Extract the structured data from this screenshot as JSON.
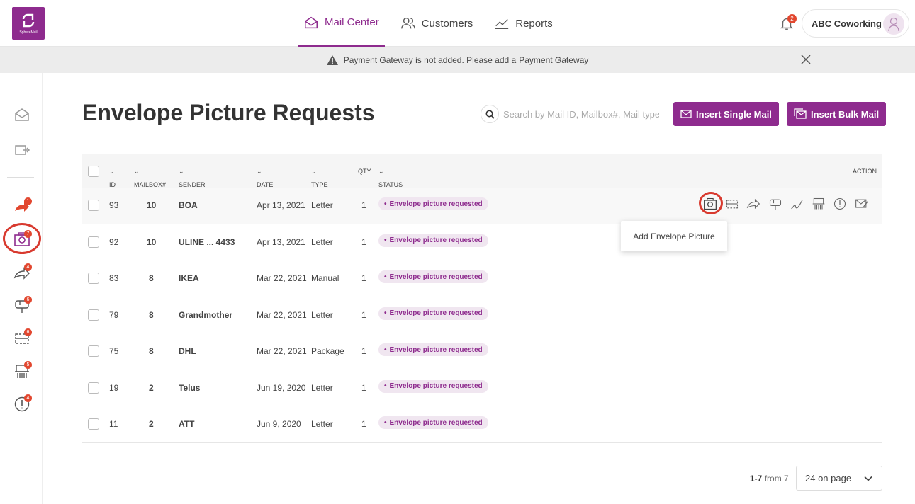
{
  "brand": {
    "logo_text": "SphereMail",
    "accent": "#8e2b8e"
  },
  "nav": {
    "items": [
      {
        "label": "Mail Center",
        "icon": "mail-open-icon",
        "active": true
      },
      {
        "label": "Customers",
        "icon": "users-icon",
        "active": false
      },
      {
        "label": "Reports",
        "icon": "line-chart-icon",
        "active": false
      }
    ],
    "notifications_count": "2",
    "account_name": "ABC Coworking"
  },
  "banner": {
    "message": "Payment Gateway is not added. Please add a",
    "link": "Payment Gateway"
  },
  "sidebar": {
    "badges": [
      "1",
      "7",
      "4",
      "6",
      "6",
      "5",
      "4"
    ]
  },
  "page": {
    "title": "Envelope Picture Requests",
    "search_placeholder": "Search by Mail ID, Mailbox#, Mail type",
    "insert_single": "Insert Single Mail",
    "insert_bulk": "Insert Bulk Mail"
  },
  "table": {
    "headers": {
      "id": "ID",
      "mailbox": "MAILBOX#",
      "sender": "SENDER",
      "date": "DATE",
      "type": "TYPE",
      "qty": "QTY.",
      "status": "STATUS",
      "action": "ACTION"
    },
    "rows": [
      {
        "id": "93",
        "mailbox": "10",
        "sender": "BOA",
        "date": "Apr 13, 2021",
        "type": "Letter",
        "qty": "1",
        "status": "Envelope picture requested"
      },
      {
        "id": "92",
        "mailbox": "10",
        "sender": "ULINE ... 4433",
        "date": "Apr 13, 2021",
        "type": "Letter",
        "qty": "1",
        "status": "Envelope picture requested"
      },
      {
        "id": "83",
        "mailbox": "8",
        "sender": "IKEA",
        "date": "Mar 22, 2021",
        "type": "Manual",
        "qty": "1",
        "status": "Envelope picture requested"
      },
      {
        "id": "79",
        "mailbox": "8",
        "sender": "Grandmother",
        "date": "Mar 22, 2021",
        "type": "Letter",
        "qty": "1",
        "status": "Envelope picture requested"
      },
      {
        "id": "75",
        "mailbox": "8",
        "sender": "DHL",
        "date": "Mar 22, 2021",
        "type": "Package",
        "qty": "1",
        "status": "Envelope picture requested"
      },
      {
        "id": "19",
        "mailbox": "2",
        "sender": "Telus",
        "date": "Jun 19, 2020",
        "type": "Letter",
        "qty": "1",
        "status": "Envelope picture requested"
      },
      {
        "id": "11",
        "mailbox": "2",
        "sender": "ATT",
        "date": "Jun 9, 2020",
        "type": "Letter",
        "qty": "1",
        "status": "Envelope picture requested"
      }
    ]
  },
  "tooltip": "Add Envelope Picture",
  "pager": {
    "range": "1-7",
    "from_label": "from 7",
    "per_page": "24 on page"
  }
}
